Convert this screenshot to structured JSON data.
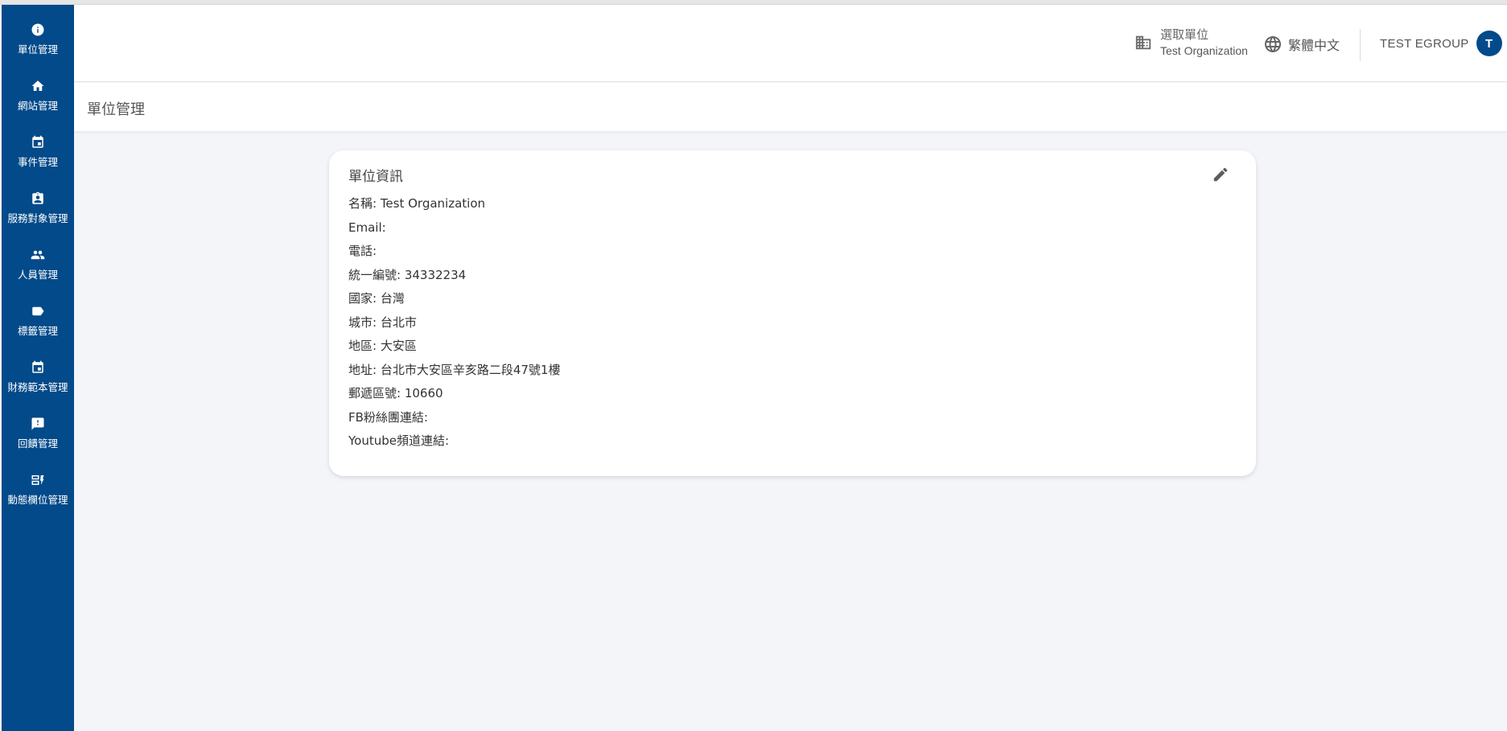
{
  "sidebar": {
    "items": [
      {
        "label": "單位管理",
        "icon": "info-icon"
      },
      {
        "label": "網站管理",
        "icon": "home-icon"
      },
      {
        "label": "事件管理",
        "icon": "calendar-icon"
      },
      {
        "label": "服務對象管理",
        "icon": "badge-icon"
      },
      {
        "label": "人員管理",
        "icon": "people-icon"
      },
      {
        "label": "標籤管理",
        "icon": "label-icon"
      },
      {
        "label": "財務範本管理",
        "icon": "calendar-icon"
      },
      {
        "label": "回饋管理",
        "icon": "feedback-icon"
      },
      {
        "label": "動態欄位管理",
        "icon": "dynamic-fields-icon"
      }
    ],
    "bg_color": "#024a8a"
  },
  "header": {
    "org_label": "選取單位",
    "org_name": "Test Organization",
    "language": "繁體中文",
    "user_name": "TEST EGROUP",
    "avatar_letter": "T"
  },
  "page": {
    "title": "單位管理"
  },
  "card": {
    "title": "單位資訊",
    "fields": [
      "名稱: Test Organization",
      "Email:",
      "電話:",
      "統一編號: 34332234",
      "國家: 台灣",
      "城市: 台北市",
      "地區: 大安區",
      "地址: 台北市大安區辛亥路二段47號1樓",
      "郵遞區號: 10660",
      "FB粉絲團連結:",
      "Youtube頻道連結:"
    ]
  }
}
